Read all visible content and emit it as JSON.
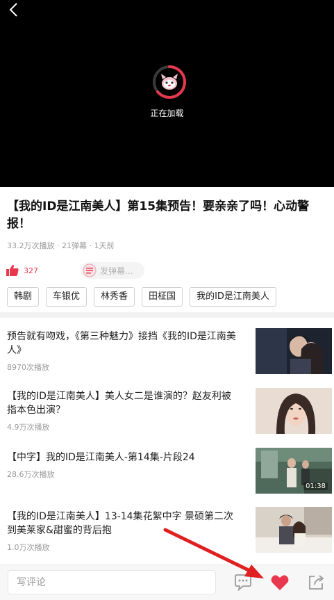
{
  "player": {
    "loading_text": "正在加载"
  },
  "video": {
    "title": "【我的ID是江南美人】第15集预告！要亲亲了吗！心动警报！",
    "meta": "33.2万次播放 · 21弹幕 · 1天前",
    "like_count": "327",
    "danmaku_placeholder": "发弹幕..."
  },
  "tags": [
    "韩剧",
    "车银优",
    "林秀香",
    "田柾国",
    "我的ID是江南美人"
  ],
  "related": [
    {
      "title": "预告就有吻戏，《第三种魅力》接挡《我的ID是江南美人》",
      "views": "8970次播放",
      "duration": ""
    },
    {
      "title": "【我的ID是江南美人】美人女二是谁演的？赵友利被指本色出演？",
      "views": "4.9万次播放",
      "duration": ""
    },
    {
      "title": "【中字】我的ID是江南美人-第14集-片段24",
      "views": "28.6万次播放",
      "duration": "01:38"
    },
    {
      "title": "【我的ID是江南美人】13-14集花絮中字 景硕第二次到美莱家&甜蜜的背后抱",
      "views": "1.0万次播放",
      "duration": ""
    }
  ],
  "bottom_bar": {
    "comment_placeholder": "写评论"
  },
  "colors": {
    "accent": "#e8384d",
    "annotation_arrow": "#e02020"
  },
  "icons": {
    "back": "chevron-left-icon",
    "loader": "cat-mascot-loader-icon",
    "like": "thumbs-up-icon",
    "danmaku": "danmaku-bullet-icon",
    "comment": "comment-bubble-icon",
    "favorite": "heart-icon",
    "share": "share-icon"
  }
}
